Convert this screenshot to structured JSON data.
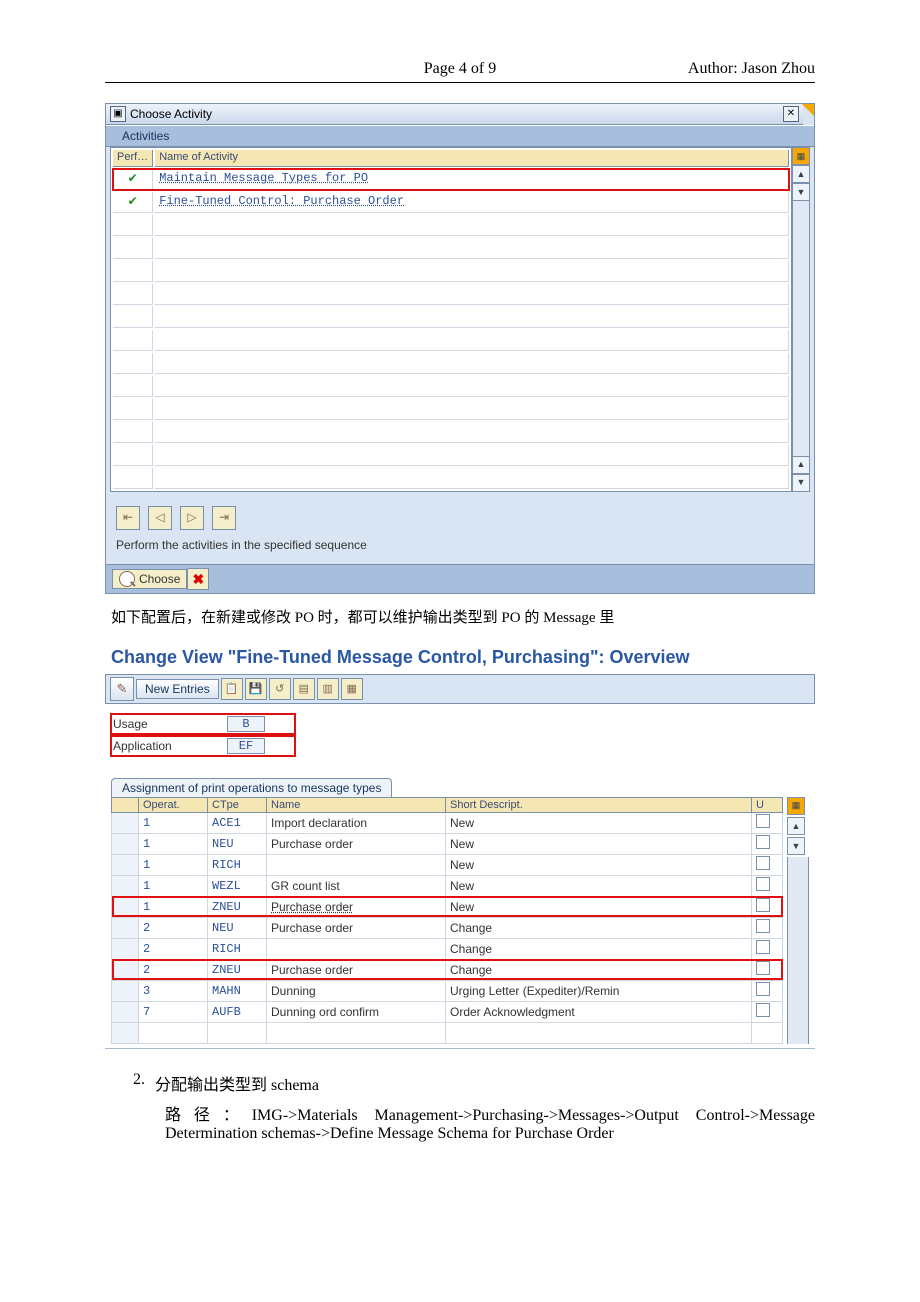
{
  "header": {
    "author": "Author: Jason Zhou",
    "page": "Page 4 of 9"
  },
  "dialog1": {
    "title": "Choose Activity",
    "section": "Activities",
    "cols": {
      "perf": "Perf…",
      "name": "Name of Activity"
    },
    "rows": [
      {
        "check": "✔",
        "name": "Maintain Message Types for PO",
        "redbox": true
      },
      {
        "check": "✔",
        "name": "Fine-Tuned Control: Purchase Order",
        "redbox": false
      }
    ],
    "instruction": "Perform the activities in the specified sequence",
    "choose_label": "Choose"
  },
  "para1": "如下配置后，在新建或修改 PO 时，都可以维护输出类型到 PO 的 Message 里",
  "changeview": {
    "title": "Change View \"Fine-Tuned Message Control, Purchasing\": Overview",
    "new_entries": "New Entries",
    "usage_label": "Usage",
    "usage_val": "B",
    "app_label": "Application",
    "app_val": "EF",
    "tab_label": "Assignment of print operations to message types",
    "cols": {
      "operat": "Operat.",
      "ctpe": "CTpe",
      "name": "Name",
      "desc": "Short Descript.",
      "u": "U"
    },
    "rows": [
      {
        "op": "1",
        "ct": "ACE1",
        "name": "Import declaration",
        "desc": "New",
        "red": false
      },
      {
        "op": "1",
        "ct": "NEU",
        "name": "Purchase order",
        "desc": "New",
        "red": false
      },
      {
        "op": "1",
        "ct": "RICH",
        "name": "",
        "desc": "New",
        "red": false
      },
      {
        "op": "1",
        "ct": "WEZL",
        "name": "GR count list",
        "desc": "New",
        "red": false
      },
      {
        "op": "1",
        "ct": "ZNEU",
        "name": "Purchase order",
        "desc": "New",
        "red": true
      },
      {
        "op": "2",
        "ct": "NEU",
        "name": "Purchase order",
        "desc": "Change",
        "red": false
      },
      {
        "op": "2",
        "ct": "RICH",
        "name": "",
        "desc": "Change",
        "red": false
      },
      {
        "op": "2",
        "ct": "ZNEU",
        "name": "Purchase order",
        "desc": "Change",
        "red": true
      },
      {
        "op": "3",
        "ct": "MAHN",
        "name": "Dunning",
        "desc": "Urging Letter (Expediter)/Remin",
        "red": false
      },
      {
        "op": "7",
        "ct": "AUFB",
        "name": "Dunning ord confirm",
        "desc": "Order Acknowledgment",
        "red": false
      }
    ]
  },
  "item2_num": "2.",
  "item2_text": "分配输出类型到 schema",
  "item2_path": "路径：IMG->Materials  Management->Purchasing->Messages->Output  Control->Message Determination schemas->Define Message Schema for Purchase Order"
}
